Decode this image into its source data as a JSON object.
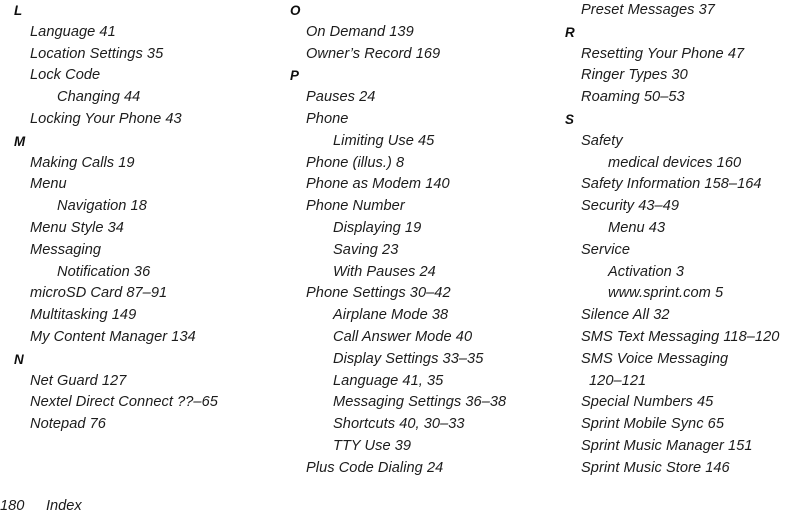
{
  "page": {
    "number": "180",
    "section_label": "Index",
    "background_color": "#ffffff",
    "text_color": "#1c1c1c"
  },
  "columns": [
    {
      "id": "column-1",
      "lines": [
        {
          "kind": "letter",
          "text": "L"
        },
        {
          "kind": "lvl1",
          "text": "Language 41"
        },
        {
          "kind": "lvl1",
          "text": "Location Settings 35"
        },
        {
          "kind": "lvl1",
          "text": "Lock Code"
        },
        {
          "kind": "lvl2",
          "text": "Changing 44"
        },
        {
          "kind": "lvl1",
          "text": "Locking Your Phone 43"
        },
        {
          "kind": "letter",
          "text": "M"
        },
        {
          "kind": "lvl1",
          "text": "Making Calls 19"
        },
        {
          "kind": "lvl1",
          "text": "Menu"
        },
        {
          "kind": "lvl2",
          "text": "Navigation 18"
        },
        {
          "kind": "lvl1",
          "text": "Menu Style 34"
        },
        {
          "kind": "lvl1",
          "text": "Messaging"
        },
        {
          "kind": "lvl2",
          "text": "Notification 36"
        },
        {
          "kind": "lvl1",
          "text": "microSD Card 87–91"
        },
        {
          "kind": "lvl1",
          "text": "Multitasking 149"
        },
        {
          "kind": "lvl1",
          "text": "My Content Manager 134"
        },
        {
          "kind": "letter",
          "text": "N"
        },
        {
          "kind": "lvl1",
          "text": "Net Guard 127"
        },
        {
          "kind": "lvl1",
          "text": "Nextel Direct Connect ??–65"
        },
        {
          "kind": "lvl1",
          "text": "Notepad 76"
        }
      ]
    },
    {
      "id": "column-2",
      "lines": [
        {
          "kind": "letter",
          "text": "O"
        },
        {
          "kind": "lvl1",
          "text": "On Demand 139"
        },
        {
          "kind": "lvl1",
          "text": "Owner’s Record 169"
        },
        {
          "kind": "letter",
          "text": "P"
        },
        {
          "kind": "lvl1",
          "text": "Pauses 24"
        },
        {
          "kind": "lvl1",
          "text": "Phone"
        },
        {
          "kind": "lvl2",
          "text": "Limiting Use 45"
        },
        {
          "kind": "lvl1",
          "text": "Phone (illus.) 8"
        },
        {
          "kind": "lvl1",
          "text": "Phone as Modem 140"
        },
        {
          "kind": "lvl1",
          "text": "Phone Number"
        },
        {
          "kind": "lvl2",
          "text": "Displaying 19"
        },
        {
          "kind": "lvl2",
          "text": "Saving 23"
        },
        {
          "kind": "lvl2",
          "text": "With Pauses 24"
        },
        {
          "kind": "lvl1",
          "text": "Phone Settings 30–42"
        },
        {
          "kind": "lvl2",
          "text": "Airplane Mode 38"
        },
        {
          "kind": "lvl2",
          "text": "Call Answer Mode 40"
        },
        {
          "kind": "lvl2",
          "text": "Display Settings 33–35"
        },
        {
          "kind": "lvl2",
          "text": "Language 41, 35"
        },
        {
          "kind": "lvl2",
          "text": "Messaging Settings 36–38"
        },
        {
          "kind": "lvl2",
          "text": "Shortcuts 40, 30–33"
        },
        {
          "kind": "lvl2",
          "text": "TTY Use 39"
        },
        {
          "kind": "lvl1",
          "text": "Plus Code Dialing 24"
        }
      ]
    },
    {
      "id": "column-3",
      "lines": [
        {
          "kind": "lvl1",
          "text": "Preset Messages 37"
        },
        {
          "kind": "letter",
          "text": "R"
        },
        {
          "kind": "lvl1",
          "text": "Resetting Your Phone 47"
        },
        {
          "kind": "lvl1",
          "text": "Ringer Types 30"
        },
        {
          "kind": "lvl1",
          "text": "Roaming 50–53"
        },
        {
          "kind": "letter",
          "text": "S"
        },
        {
          "kind": "lvl1",
          "text": "Safety"
        },
        {
          "kind": "lvl2",
          "text": "medical devices 160"
        },
        {
          "kind": "lvl1",
          "text": "Safety Information 158–164"
        },
        {
          "kind": "lvl1",
          "text": "Security 43–49"
        },
        {
          "kind": "lvl2",
          "text": "Menu 43"
        },
        {
          "kind": "lvl1",
          "text": "Service"
        },
        {
          "kind": "lvl2",
          "text": "Activation 3"
        },
        {
          "kind": "lvl2",
          "text": "www.sprint.com 5"
        },
        {
          "kind": "lvl1",
          "text": "Silence All 32"
        },
        {
          "kind": "lvl1",
          "text": "SMS Text Messaging 118–120"
        },
        {
          "kind": "lvl1",
          "text": "SMS Voice Messaging"
        },
        {
          "kind": "cont",
          "text": "120–121"
        },
        {
          "kind": "lvl1",
          "text": "Special Numbers 45"
        },
        {
          "kind": "lvl1",
          "text": "Sprint Mobile Sync 65"
        },
        {
          "kind": "lvl1",
          "text": "Sprint Music Manager 151"
        },
        {
          "kind": "lvl1",
          "text": "Sprint Music Store 146"
        }
      ]
    }
  ]
}
